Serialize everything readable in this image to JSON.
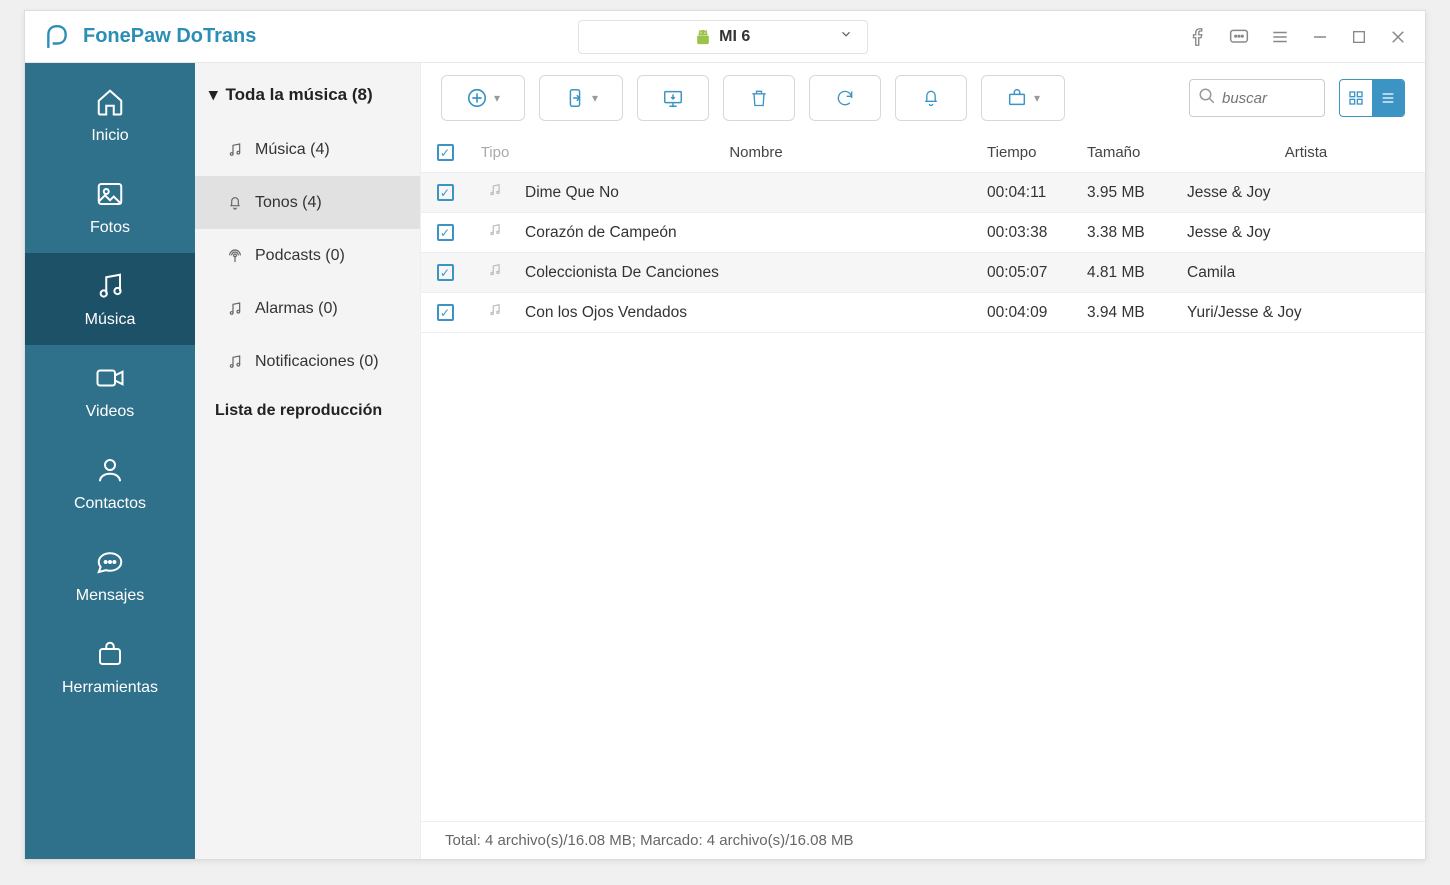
{
  "app": {
    "title": "FonePaw DoTrans"
  },
  "device": {
    "name": "MI 6"
  },
  "sidebar": {
    "items": [
      {
        "label": "Inicio"
      },
      {
        "label": "Fotos"
      },
      {
        "label": "Música"
      },
      {
        "label": "Videos"
      },
      {
        "label": "Contactos"
      },
      {
        "label": "Mensajes"
      },
      {
        "label": "Herramientas"
      }
    ]
  },
  "categories": {
    "header": "Toda la música (8)",
    "items": [
      {
        "label": "Música (4)"
      },
      {
        "label": "Tonos (4)"
      },
      {
        "label": "Podcasts (0)"
      },
      {
        "label": "Alarmas (0)"
      },
      {
        "label": "Notificaciones (0)"
      }
    ],
    "playlist_header": "Lista de reproducción"
  },
  "search": {
    "placeholder": "buscar"
  },
  "table": {
    "columns": {
      "type": "Tipo",
      "name": "Nombre",
      "time": "Tiempo",
      "size": "Tamaño",
      "artist": "Artista"
    },
    "rows": [
      {
        "name": "Dime Que No",
        "time": "00:04:11",
        "size": "3.95 MB",
        "artist": "Jesse & Joy"
      },
      {
        "name": "Corazón de Campeón",
        "time": "00:03:38",
        "size": "3.38 MB",
        "artist": "Jesse & Joy"
      },
      {
        "name": "Coleccionista De Canciones",
        "time": "00:05:07",
        "size": "4.81 MB",
        "artist": "Camila"
      },
      {
        "name": "Con los Ojos Vendados",
        "time": "00:04:09",
        "size": "3.94 MB",
        "artist": "Yuri/Jesse & Joy"
      }
    ]
  },
  "status": {
    "text": "Total: 4 archivo(s)/16.08 MB; Marcado: 4 archivo(s)/16.08 MB"
  }
}
